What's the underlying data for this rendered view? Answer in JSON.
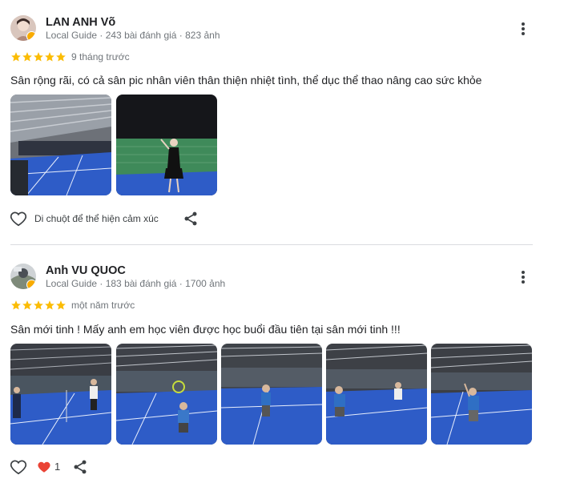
{
  "reviews": [
    {
      "name": "LAN ANH Võ",
      "meta": "Local Guide · 243 bài đánh giá · 823 ảnh",
      "rating": 5,
      "date": "9 tháng trước",
      "text": "Sân rộng rãi, có cả sân pic nhân viên thân thiện nhiệt tình, thể dục thể thao nâng cao sức khỏe",
      "like_hint": "Di chuột để thể hiện cảm xúc",
      "photo_count": 2
    },
    {
      "name": "Anh VU QUOC",
      "meta": "Local Guide · 183 bài đánh giá · 1700 ảnh",
      "rating": 5,
      "date": "một năm trước",
      "text": "Sân mới tinh ! Mấy anh em học viên được học buổi đầu tiên tại sân mới tinh !!!",
      "reaction_count": "1",
      "photo_count": 5
    }
  ],
  "icons": {
    "more": "more-vert-icon",
    "star": "star-icon",
    "like": "heart-outline-icon",
    "reaction": "heart-filled-icon",
    "share": "share-icon"
  },
  "colors": {
    "star": "#fbbc04",
    "reaction_heart": "#ea4335",
    "court_blue": "#2e5cc7",
    "badge": "#f9ab00"
  }
}
